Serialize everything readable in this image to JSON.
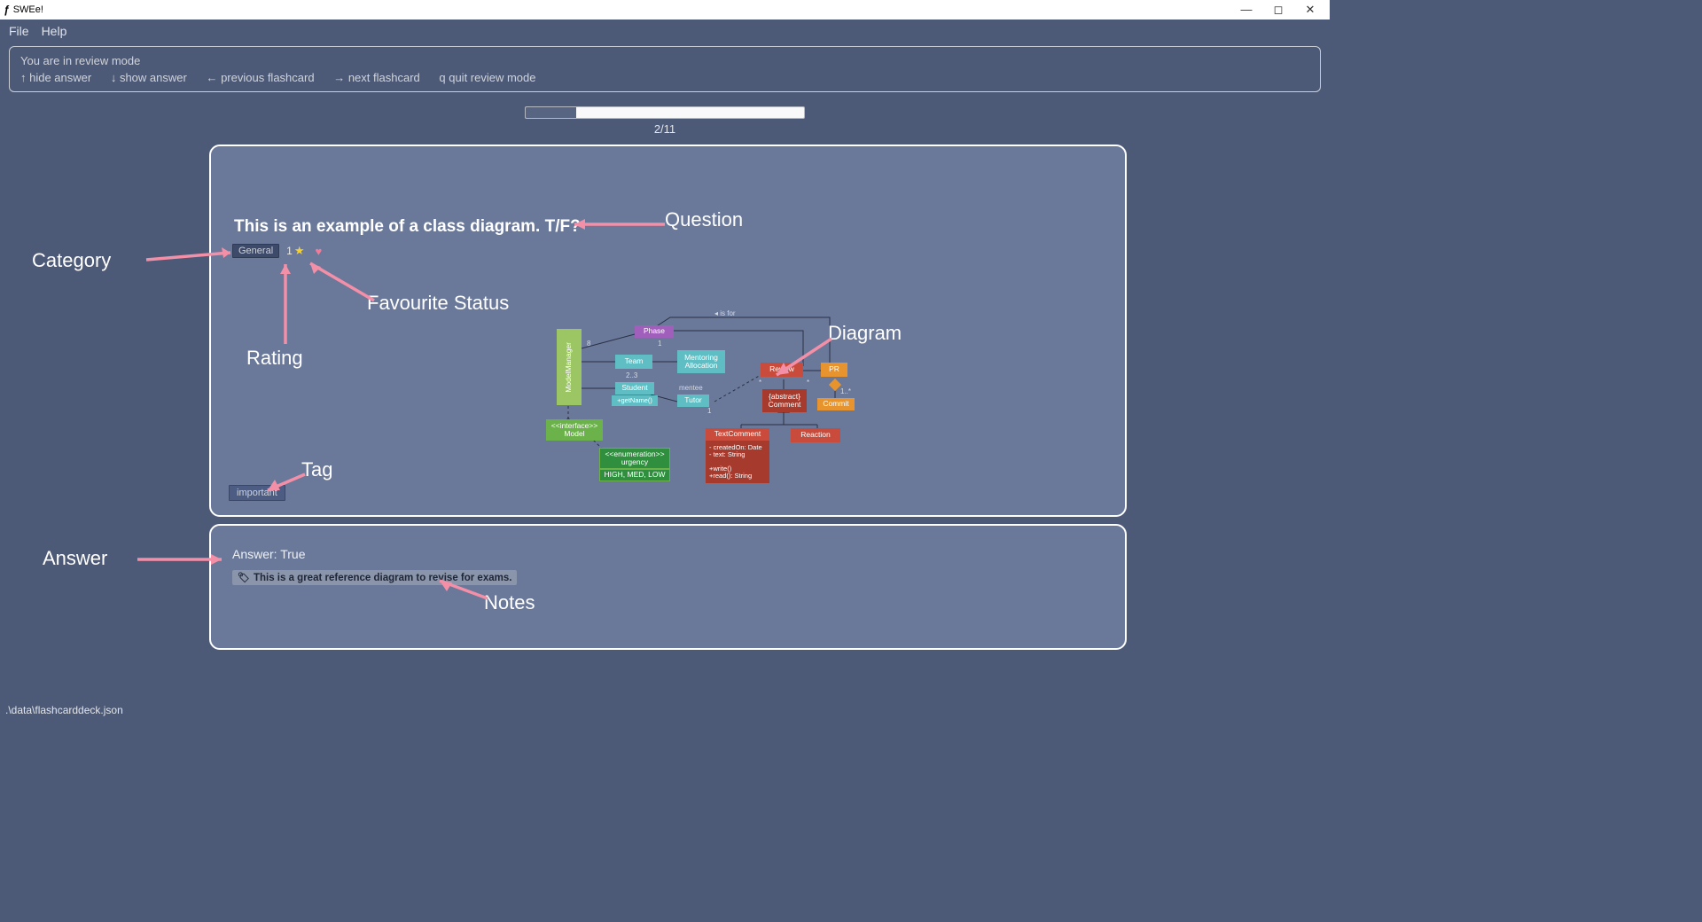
{
  "titlebar": {
    "app_name": "SWEe!"
  },
  "menu": {
    "file": "File",
    "help": "Help"
  },
  "infobox": {
    "mode_line": "You are in review mode",
    "hints": [
      "↑ hide answer",
      "↓ show answer",
      "← previous flashcard",
      "→ next flashcard",
      "q quit review mode"
    ]
  },
  "progress": {
    "label": "2/11",
    "current": 2,
    "total": 11,
    "percent": 18.18
  },
  "card": {
    "question": "This is an example of a class diagram. T/F?",
    "category": "General",
    "rating_value": "1",
    "favourite": true,
    "tag": "important",
    "answer": "Answer: True",
    "note": "This is a great reference diagram to revise for exams."
  },
  "annotations": {
    "category": "Category",
    "rating": "Rating",
    "favourite": "Favourite Status",
    "question": "Question",
    "diagram": "Diagram",
    "tag": "Tag",
    "answer": "Answer",
    "notes": "Notes"
  },
  "diagram_boxes": {
    "model_manager": "ModelManager",
    "phase": "Phase",
    "team": "Team",
    "mentoring": "Mentoring Allocation",
    "student": "Student",
    "getname": "+getName()",
    "tutor": "Tutor",
    "interface": "<<interface>>\nModel",
    "enumeration": "<<enumeration>>\nurgency",
    "enum_vals": "HIGH, MED, LOW",
    "review": "Review",
    "abstract_comment": "{abstract}\nComment",
    "text_comment": "TextComment",
    "tc_attrs": "- createdOn: Date\n- text: String",
    "tc_ops": "+write()\n+read(): String",
    "reaction": "Reaction",
    "pr": "PR",
    "commit": "Commit",
    "is_for": "◂ is for",
    "mentee": "mentee",
    "m_8": "8",
    "m_23": "2..3",
    "m_1a": "1",
    "m_1b": "1",
    "m_star": "*",
    "m_1s": "1..*",
    "m_sa": "*"
  },
  "statusbar": {
    "path": ".\\data\\flashcarddeck.json"
  }
}
